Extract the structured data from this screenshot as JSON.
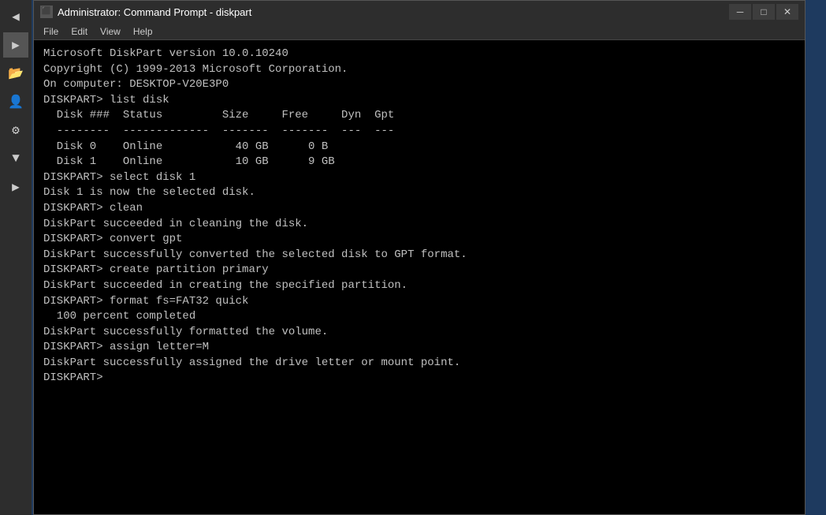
{
  "window": {
    "title": "Administrator: Command Prompt - diskpart",
    "icon": "cmd-icon",
    "minimize_label": "─",
    "maximize_label": "□",
    "close_label": "✕"
  },
  "menu": {
    "items": [
      "File",
      "Edit",
      "View",
      "Help"
    ]
  },
  "terminal": {
    "lines": [
      "Microsoft DiskPart version 10.0.10240",
      "",
      "Copyright (C) 1999-2013 Microsoft Corporation.",
      "On computer: DESKTOP-V20E3P0",
      "",
      "DISKPART> list disk",
      "",
      "  Disk ###  Status         Size     Free     Dyn  Gpt",
      "  --------  -------------  -------  -------  ---  ---",
      "  Disk 0    Online           40 GB      0 B",
      "  Disk 1    Online           10 GB      9 GB",
      "",
      "DISKPART> select disk 1",
      "",
      "Disk 1 is now the selected disk.",
      "",
      "DISKPART> clean",
      "",
      "DiskPart succeeded in cleaning the disk.",
      "",
      "DISKPART> convert gpt",
      "",
      "DiskPart successfully converted the selected disk to GPT format.",
      "",
      "DISKPART> create partition primary",
      "",
      "DiskPart succeeded in creating the specified partition.",
      "",
      "DISKPART> format fs=FAT32 quick",
      "",
      "  100 percent completed",
      "",
      "DiskPart successfully formatted the volume.",
      "",
      "DISKPART> assign letter=M",
      "",
      "DiskPart successfully assigned the drive letter or mount point.",
      "",
      "DISKPART>"
    ]
  },
  "taskbar": {
    "icons": [
      {
        "name": "arrow-back-icon",
        "symbol": "◀"
      },
      {
        "name": "arrow-forward-icon",
        "symbol": "▶"
      },
      {
        "name": "file-icon",
        "symbol": "📁"
      },
      {
        "name": "user-icon",
        "symbol": "👤"
      },
      {
        "name": "settings-icon",
        "symbol": "⚙"
      },
      {
        "name": "down-arrow-icon",
        "symbol": "▼"
      },
      {
        "name": "expand-icon",
        "symbol": "▶"
      }
    ]
  }
}
